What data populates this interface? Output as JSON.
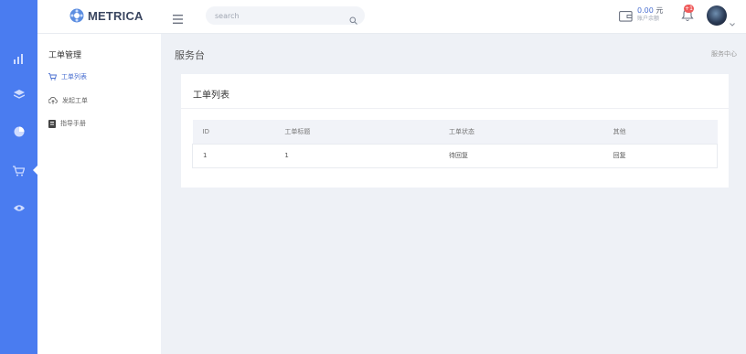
{
  "brand": {
    "logo_text": "METRICA",
    "accent": "#4a7cf0"
  },
  "rail": {
    "items": [
      {
        "icon": "bar-chart-icon"
      },
      {
        "icon": "layers-icon"
      },
      {
        "icon": "pie-chart-icon"
      },
      {
        "icon": "cart-icon",
        "active": true
      },
      {
        "icon": "eye-icon"
      }
    ]
  },
  "topbar": {
    "search": {
      "placeholder": "search"
    },
    "balance": {
      "amount": "0.00",
      "currency": "元",
      "label": "账户余额"
    },
    "notifications": {
      "badge": "+1"
    }
  },
  "subnav": {
    "heading": "工单管理",
    "items": [
      {
        "label": "工单列表",
        "icon": "cart-icon",
        "active": true
      },
      {
        "label": "发起工单",
        "icon": "upload-cloud-icon"
      },
      {
        "label": "指导手册",
        "icon": "book-icon"
      }
    ]
  },
  "main": {
    "page_title": "服务台",
    "breadcrumb": "服务中心",
    "card_title": "工单列表",
    "table": {
      "columns": [
        "ID",
        "工单标题",
        "工单状态",
        "其他"
      ],
      "rows": [
        [
          "1",
          "1",
          "待回复",
          "回复"
        ]
      ]
    }
  }
}
